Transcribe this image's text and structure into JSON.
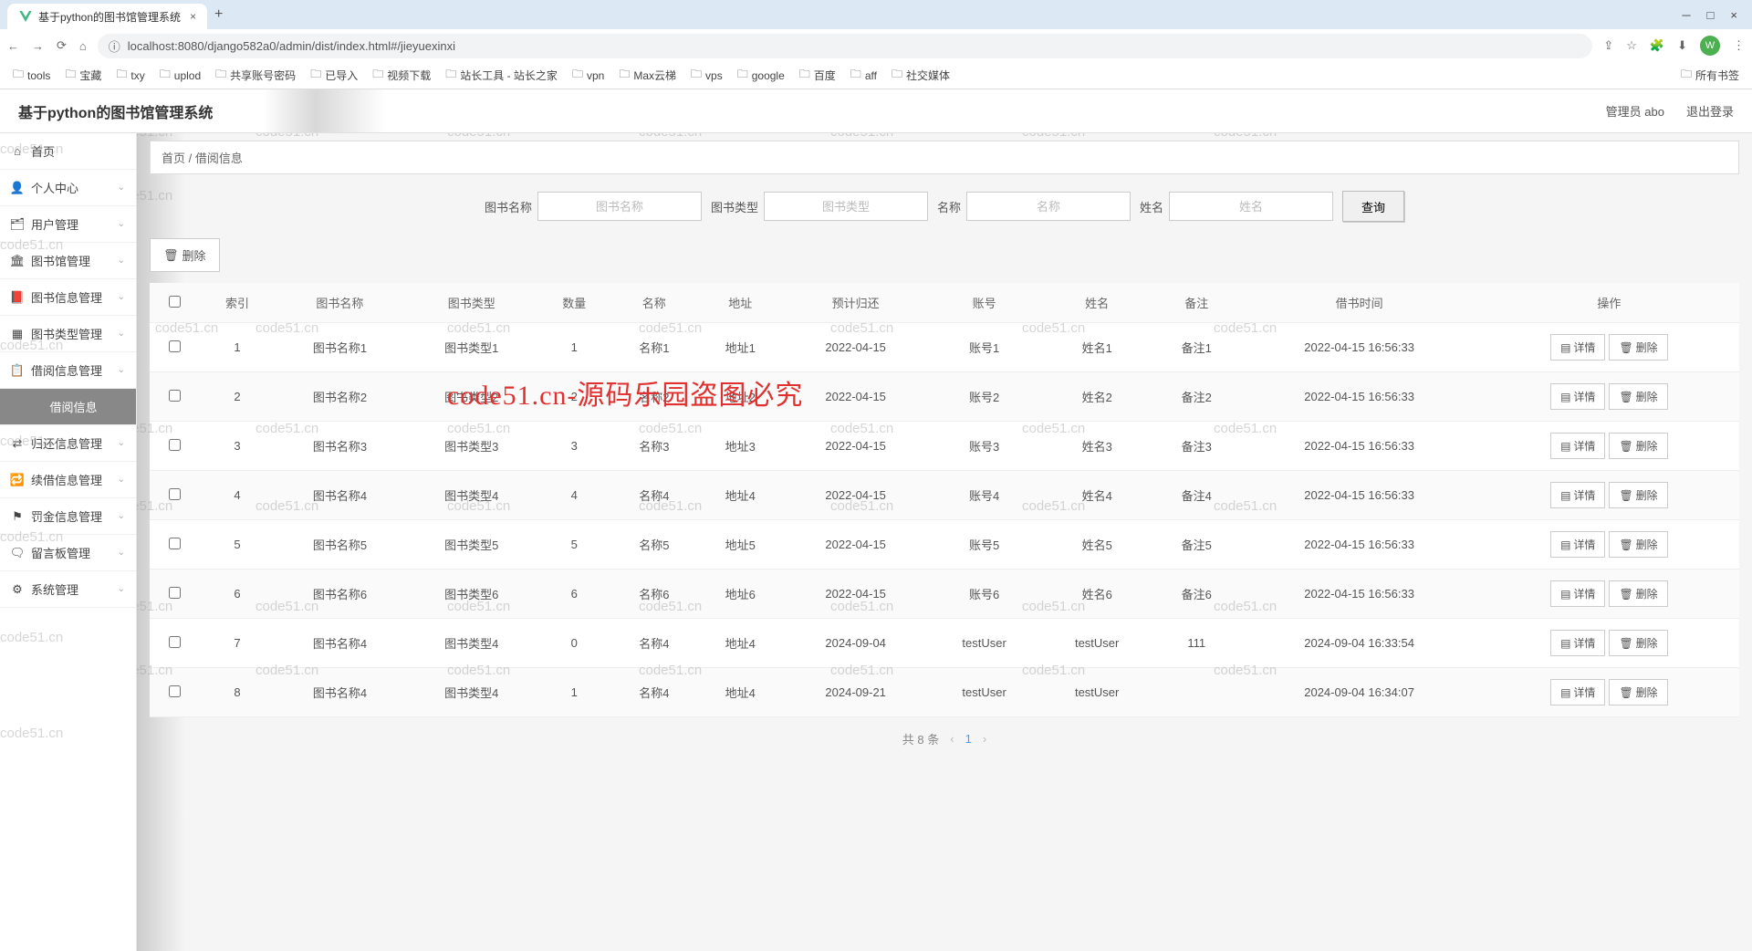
{
  "browser": {
    "tab_title": "基于python的图书馆管理系统",
    "url": "localhost:8080/django582a0/admin/dist/index.html#/jieyuexinxi",
    "avatar_letter": "W",
    "bookmarks": [
      "tools",
      "宝藏",
      "txy",
      "uplod",
      "共享账号密码",
      "已导入",
      "视频下载",
      "站长工具 - 站长之家",
      "vpn",
      "Max云梯",
      "vps",
      "google",
      "百度",
      "aff",
      "社交媒体"
    ],
    "all_bookmarks": "所有书签"
  },
  "app": {
    "title": "基于python的图书馆管理系统",
    "admin_label": "管理员 abo",
    "logout_label": "退出登录"
  },
  "sidebar": {
    "items": [
      {
        "icon": "home",
        "label": "首页",
        "expandable": false
      },
      {
        "icon": "user",
        "label": "个人中心",
        "expandable": true
      },
      {
        "icon": "users",
        "label": "用户管理",
        "expandable": true
      },
      {
        "icon": "building",
        "label": "图书馆管理",
        "expandable": true
      },
      {
        "icon": "book",
        "label": "图书信息管理",
        "expandable": true
      },
      {
        "icon": "grid",
        "label": "图书类型管理",
        "expandable": true
      },
      {
        "icon": "clipboard",
        "label": "借阅信息管理",
        "expandable": true
      },
      {
        "icon": "sub",
        "label": "借阅信息",
        "expandable": false,
        "sub": true
      },
      {
        "icon": "return",
        "label": "归还信息管理",
        "expandable": true
      },
      {
        "icon": "renew",
        "label": "续借信息管理",
        "expandable": true
      },
      {
        "icon": "fine",
        "label": "罚金信息管理",
        "expandable": true
      },
      {
        "icon": "board",
        "label": "留言板管理",
        "expandable": true
      },
      {
        "icon": "system",
        "label": "系统管理",
        "expandable": true
      }
    ]
  },
  "breadcrumb": {
    "home": "首页",
    "sep": "/",
    "current": "借阅信息"
  },
  "search": {
    "fields": [
      {
        "label": "图书名称",
        "placeholder": "图书名称"
      },
      {
        "label": "图书类型",
        "placeholder": "图书类型"
      },
      {
        "label": "名称",
        "placeholder": "名称"
      },
      {
        "label": "姓名",
        "placeholder": "姓名"
      }
    ],
    "query_btn": "查询"
  },
  "delete_btn": "删除",
  "table": {
    "headers": [
      "",
      "索引",
      "图书名称",
      "图书类型",
      "数量",
      "名称",
      "地址",
      "预计归还",
      "账号",
      "姓名",
      "备注",
      "借书时间",
      "操作"
    ],
    "detail_btn": "详情",
    "delete_btn": "删除",
    "rows": [
      {
        "idx": "1",
        "bookname": "图书名称1",
        "booktype": "图书类型1",
        "qty": "1",
        "name": "名称1",
        "addr": "地址1",
        "due": "2022-04-15",
        "account": "账号1",
        "uname": "姓名1",
        "note": "备注1",
        "time": "2022-04-15 16:56:33"
      },
      {
        "idx": "2",
        "bookname": "图书名称2",
        "booktype": "图书类型2",
        "qty": "2",
        "name": "名称2",
        "addr": "地址2",
        "due": "2022-04-15",
        "account": "账号2",
        "uname": "姓名2",
        "note": "备注2",
        "time": "2022-04-15 16:56:33"
      },
      {
        "idx": "3",
        "bookname": "图书名称3",
        "booktype": "图书类型3",
        "qty": "3",
        "name": "名称3",
        "addr": "地址3",
        "due": "2022-04-15",
        "account": "账号3",
        "uname": "姓名3",
        "note": "备注3",
        "time": "2022-04-15 16:56:33"
      },
      {
        "idx": "4",
        "bookname": "图书名称4",
        "booktype": "图书类型4",
        "qty": "4",
        "name": "名称4",
        "addr": "地址4",
        "due": "2022-04-15",
        "account": "账号4",
        "uname": "姓名4",
        "note": "备注4",
        "time": "2022-04-15 16:56:33"
      },
      {
        "idx": "5",
        "bookname": "图书名称5",
        "booktype": "图书类型5",
        "qty": "5",
        "name": "名称5",
        "addr": "地址5",
        "due": "2022-04-15",
        "account": "账号5",
        "uname": "姓名5",
        "note": "备注5",
        "time": "2022-04-15 16:56:33"
      },
      {
        "idx": "6",
        "bookname": "图书名称6",
        "booktype": "图书类型6",
        "qty": "6",
        "name": "名称6",
        "addr": "地址6",
        "due": "2022-04-15",
        "account": "账号6",
        "uname": "姓名6",
        "note": "备注6",
        "time": "2022-04-15 16:56:33"
      },
      {
        "idx": "7",
        "bookname": "图书名称4",
        "booktype": "图书类型4",
        "qty": "0",
        "name": "名称4",
        "addr": "地址4",
        "due": "2024-09-04",
        "account": "testUser",
        "uname": "testUser",
        "note": "111",
        "time": "2024-09-04 16:33:54"
      },
      {
        "idx": "8",
        "bookname": "图书名称4",
        "booktype": "图书类型4",
        "qty": "1",
        "name": "名称4",
        "addr": "地址4",
        "due": "2024-09-21",
        "account": "testUser",
        "uname": "testUser",
        "note": "",
        "time": "2024-09-04 16:34:07"
      }
    ]
  },
  "pagination": {
    "total": "共 8 条",
    "page": "1"
  },
  "watermark_small": "code51.cn",
  "watermark_big": "code51.cn-源码乐园盗图必究"
}
